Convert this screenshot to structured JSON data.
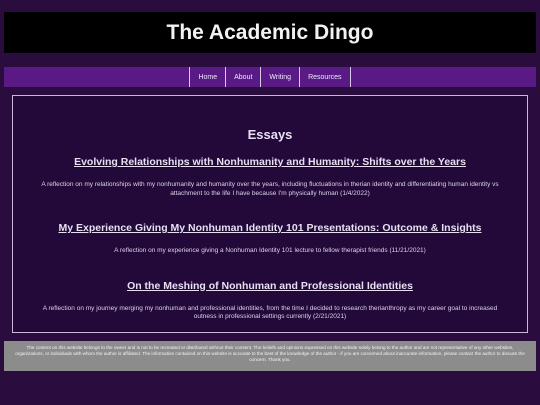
{
  "site": {
    "title": "The Academic Dingo"
  },
  "nav": {
    "items": [
      {
        "label": "Home"
      },
      {
        "label": "About"
      },
      {
        "label": "Writing"
      },
      {
        "label": "Resources"
      }
    ]
  },
  "main": {
    "section_title": "Essays",
    "essays": [
      {
        "title": "Evolving Relationships with Nonhumanity and Humanity: Shifts over the Years",
        "description": "A reflection on my relationships with my nonhumanity and humanity over the years, including fluctuations in therian identity and differentiating human identity vs attachment to the life I have because I'm physically human (1/4/2022)"
      },
      {
        "title": "My Experience Giving My Nonhuman Identity 101 Presentations: Outcome & Insights",
        "description": "A reflection on my experience giving a Nonhuman Identity 101 lecture to fellow therapist friends (11/21/2021)"
      },
      {
        "title": "On the Meshing of Nonhuman and Professional Identities",
        "description": "A reflection on my journey merging my nonhuman and professional identities, from the time I decided to research therianthropy as my career goal to increased outness in professional settings currently (2/21/2021)"
      }
    ]
  },
  "footer": {
    "text": "The content on this website belongs to the owner and is not to be recreated or distributed without their consent. The beliefs and opinions expressed on this website solely belong to the author and are not representative of any other websites, organizations, or individuals with whom the author is affiliated. The information contained on this website is accurate to the best of the knowledge of the author - if you are concerned about inaccurate information, please contact the author to discuss the concern. Thank you."
  },
  "colors": {
    "page_background": "#2a0c3f",
    "header_background": "#000000",
    "nav_background": "#5a1a86",
    "content_background": "#22093a",
    "footer_background": "#8c8c8c"
  }
}
